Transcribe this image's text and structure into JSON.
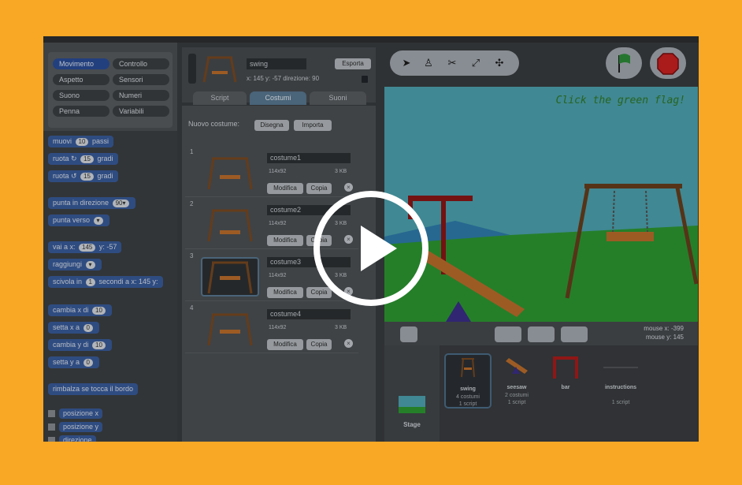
{
  "palette": {
    "categories": [
      {
        "label": "Movimento",
        "selected": true
      },
      {
        "label": "Controllo"
      },
      {
        "label": "Aspetto"
      },
      {
        "label": "Sensori"
      },
      {
        "label": "Suono"
      },
      {
        "label": "Numeri"
      },
      {
        "label": "Penna"
      },
      {
        "label": "Variabili"
      }
    ],
    "blocks": [
      {
        "pre": "muovi",
        "n": "10",
        "post": "passi"
      },
      {
        "pre": "ruota ↻",
        "n": "15",
        "post": "gradi"
      },
      {
        "pre": "ruota ↺",
        "n": "15",
        "post": "gradi"
      },
      {
        "pre": "punta in direzione",
        "n": "90▾",
        "post": ""
      },
      {
        "pre": "punta verso",
        "n": "▾",
        "post": ""
      },
      {
        "pre": "vai a x:",
        "n": "145",
        "post": "y: -57"
      },
      {
        "pre": "raggiungi",
        "n": "▾",
        "post": ""
      },
      {
        "pre": "scivola in",
        "n": "1",
        "post": "secondi a x: 145 y:"
      },
      {
        "pre": "cambia x di",
        "n": "10",
        "post": ""
      },
      {
        "pre": "setta x a",
        "n": "0",
        "post": ""
      },
      {
        "pre": "cambia y di",
        "n": "10",
        "post": ""
      },
      {
        "pre": "setta y a",
        "n": "0",
        "post": ""
      },
      {
        "pre": "rimbalza se tocca il bordo",
        "n": "",
        "post": ""
      }
    ],
    "reporters": [
      "posizione x",
      "posizione y",
      "direzione"
    ]
  },
  "sprite": {
    "name": "swing",
    "coords": "x: 145  y: -57   direzione: 90",
    "export_label": "Esporta"
  },
  "tabs": [
    {
      "label": "Script"
    },
    {
      "label": "Costumi",
      "selected": true
    },
    {
      "label": "Suoni"
    }
  ],
  "costumes_panel": {
    "new_label": "Nuovo costume:",
    "paint_label": "Disegna",
    "import_label": "Importa",
    "edit_label": "Modifica",
    "copy_label": "Copia",
    "items": [
      {
        "index": "1",
        "name": "costume1",
        "dims": "114x92",
        "size": "3 KB"
      },
      {
        "index": "2",
        "name": "costume2",
        "dims": "114x92",
        "size": "3 KB"
      },
      {
        "index": "3",
        "name": "costume3",
        "dims": "114x92",
        "size": "3 KB",
        "selected": true
      },
      {
        "index": "4",
        "name": "costume4",
        "dims": "114x92",
        "size": "3 KB"
      }
    ]
  },
  "stage": {
    "message": "Click the green flag!",
    "mouse_x": "mouse x: -399",
    "mouse_y": "mouse y: 145"
  },
  "sprites": {
    "stage_label": "Stage",
    "items": [
      {
        "name": "swing",
        "costumes": "4 costumi",
        "scripts": "1 script",
        "selected": true
      },
      {
        "name": "seesaw",
        "costumes": "2 costumi",
        "scripts": "1 script"
      },
      {
        "name": "bar",
        "costumes": "",
        "scripts": ""
      },
      {
        "name": "instructions",
        "costumes": "",
        "scripts": "1 script"
      }
    ]
  },
  "colors": {
    "frame": "#f9a826",
    "motion_blocks": "#3a5d9e",
    "stage_sky": "#4fa6b4",
    "stage_grass": "#2e9b33",
    "flag_green": "#2f8f3a",
    "stop_red": "#d02121"
  },
  "play_icon": "play-icon"
}
